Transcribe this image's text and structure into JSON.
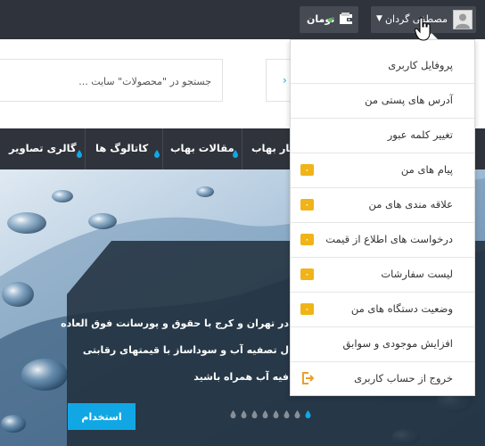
{
  "header": {
    "user_name": "مصطفی گردان",
    "caret": "▼",
    "wallet_label": "تومان",
    "wallet_dot_text": "•"
  },
  "search": {
    "placeholder": "جستجو در \"محصولات\" سایت ..."
  },
  "nav": {
    "items": [
      {
        "label": "گالری تصاویر"
      },
      {
        "label": "کاتالوگ ها"
      },
      {
        "label": "مقالات بهاب"
      },
      {
        "label": "اخبار بهاب"
      }
    ]
  },
  "hero": {
    "lines": [
      "در تهران و کرج با حقوق و پورسانت فوق العاده",
      "ل تصفیه آب و سوداساز با قیمتهای رقابتی",
      "فیه آب همراه باشید"
    ],
    "cta_label": "استخدام",
    "slides_total": 8,
    "slides_active": 1
  },
  "user_menu": {
    "items": [
      {
        "label": "پروفایل کاربری",
        "badge": ""
      },
      {
        "label": "آدرس های پستی من",
        "badge": ""
      },
      {
        "label": "تغییر کلمه عبور",
        "badge": ""
      },
      {
        "label": "پیام های من",
        "badge": "٠"
      },
      {
        "label": "علاقه مندی های من",
        "badge": "٠"
      },
      {
        "label": "درخواست های اطلاع از قیمت",
        "badge": "٠"
      },
      {
        "label": "لیست سفارشات",
        "badge": "٠"
      },
      {
        "label": "وضعیت دستگاه های من",
        "badge": "٠"
      },
      {
        "label": "افزایش موجودی و سوابق",
        "badge": ""
      },
      {
        "label": "خروج از حساب کاربری",
        "badge": ""
      }
    ]
  },
  "colors": {
    "topbar": "#2f333b",
    "accent": "#11a7e5",
    "badge": "#f0b418",
    "logout": "#f0a020"
  },
  "icons": {
    "avatar": "user-avatar-icon",
    "wallet": "wallet-icon",
    "cursor": "hand-pointer-icon",
    "logout": "logout-icon",
    "nav_drop": "water-drop-icon"
  }
}
